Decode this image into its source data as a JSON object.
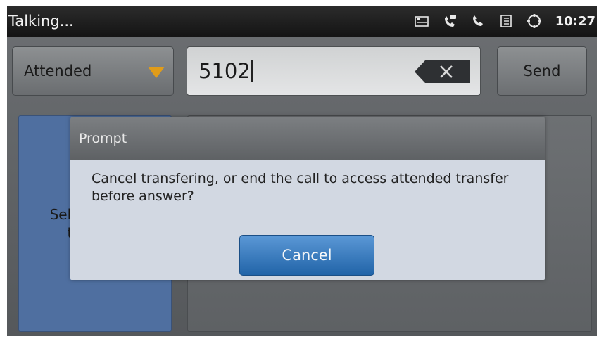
{
  "status_bar": {
    "title": "Talking...",
    "time": "10:27",
    "icons": [
      "voicemail-icon",
      "message-phone-icon",
      "phone-icon",
      "contacts-icon",
      "sync-icon"
    ]
  },
  "transfer": {
    "mode_label": "Attended",
    "number_value": "5102",
    "send_label": "Send"
  },
  "left_panel": {
    "text": "Select call to transfer"
  },
  "dialog": {
    "title": "Prompt",
    "message": "Cancel transfering, or end the call to access attended transfer before answer?",
    "cancel_label": "Cancel"
  },
  "colors": {
    "dropdown_arrow": "#e09c1a",
    "primary_button": "#2a74bf",
    "panel_blue": "#4f6fa0"
  }
}
